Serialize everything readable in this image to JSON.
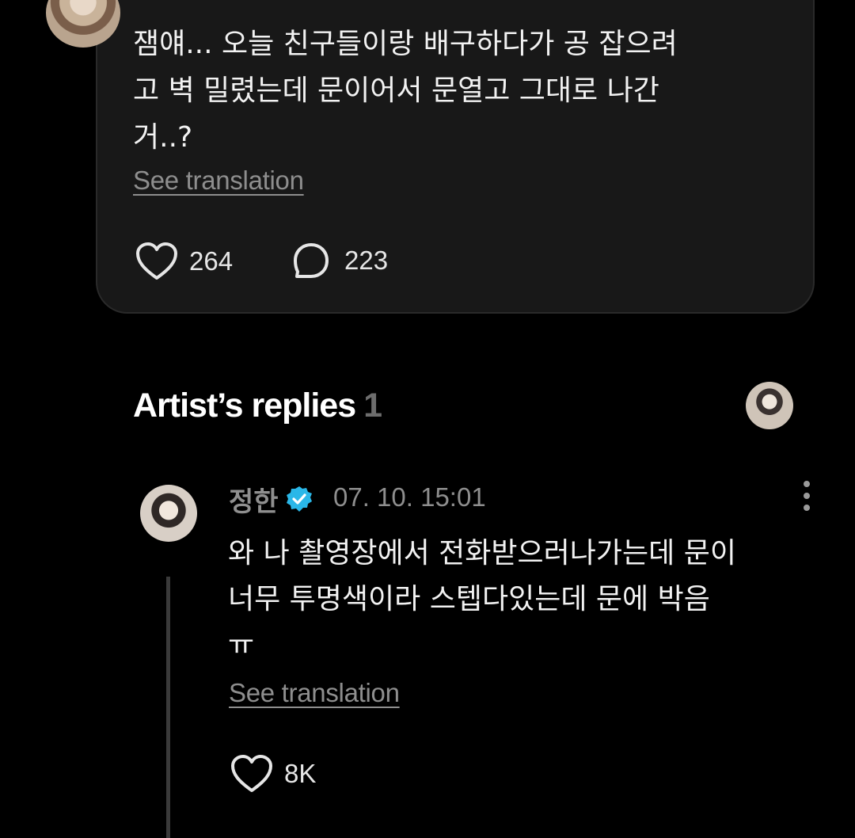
{
  "post": {
    "text": "잼얘... 오늘 친구들이랑 배구하다가 공 잡으려\n고 벽 밀렸는데 문이어서 문열고 그대로 나간\n거..?",
    "see_translation": "See translation",
    "likes": "264",
    "comments": "223"
  },
  "artist_replies": {
    "title": "Artist’s replies",
    "count": "1"
  },
  "reply": {
    "author": "정한",
    "timestamp": "07. 10. 15:01",
    "text": "와 나 촬영장에서 전화받으러나가는데 문이\n너무 투명색이라 스텝다있는데 문에 박음\nㅠ",
    "see_translation": "See translation",
    "likes": "8K"
  },
  "colors": {
    "background": "#000000",
    "card": "#181818",
    "muted_text": "#8e8e8e",
    "verified": "#2ab7e8"
  },
  "icons": {
    "like": "heart-outline-icon",
    "comment": "comment-bubble-icon",
    "verified": "verified-badge-icon",
    "more": "more-vertical-icon"
  }
}
